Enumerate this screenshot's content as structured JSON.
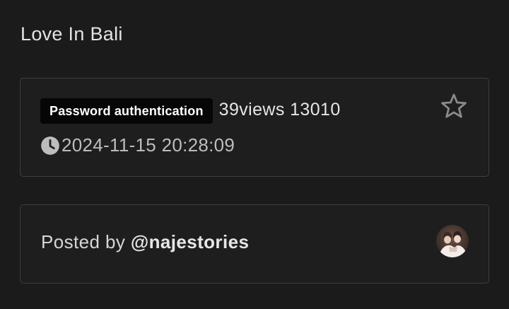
{
  "page": {
    "title": "Love In Bali"
  },
  "info_card": {
    "badge_label": "Password authentication",
    "views_text": "39views 13010",
    "timestamp": "2024-11-15 20:28:09",
    "star_icon": "star-outline-icon",
    "clock_icon": "clock-icon"
  },
  "poster_card": {
    "posted_by_prefix": "Posted by",
    "handle": "@najestories",
    "avatar_icon": "user-avatar"
  },
  "colors": {
    "background": "#1b1b1b",
    "card_background": "#1e1e1e",
    "card_border": "#3e3e3e",
    "badge_background": "#060606"
  }
}
